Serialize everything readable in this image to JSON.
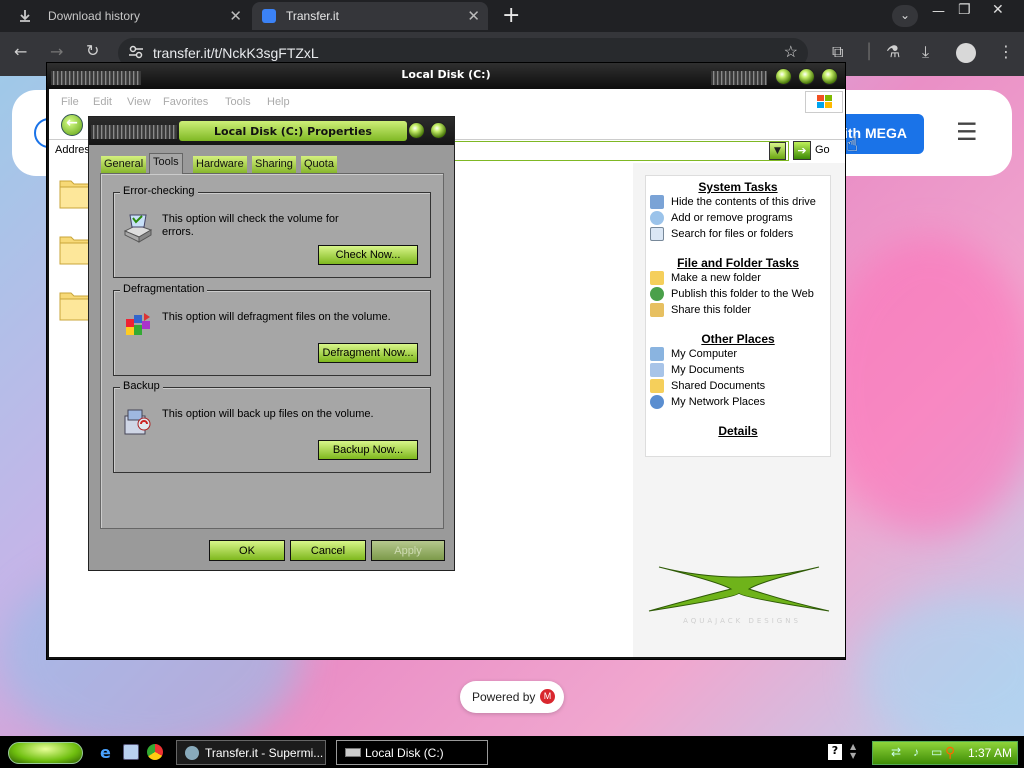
{
  "browser": {
    "tabs": [
      {
        "label": "Download history",
        "icon": "download-icon"
      },
      {
        "label": "Transfer.it",
        "icon": "transfer-icon"
      }
    ],
    "url": "transfer.it/t/NckK3sgFTZxL"
  },
  "page": {
    "mega_button": "ith MEGA",
    "powered_by": "Powered by"
  },
  "explorer": {
    "title": "Local Disk (C:)",
    "menu": [
      "File",
      "Edit",
      "View",
      "Favorites",
      "Tools",
      "Help"
    ],
    "address_label": "Addres",
    "go_label": "Go",
    "sections": [
      {
        "title": "System Tasks",
        "items": [
          "Hide the contents of this drive",
          "Add or remove programs",
          "Search for files or folders"
        ]
      },
      {
        "title": "File and Folder Tasks",
        "items": [
          "Make a new folder",
          "Publish this folder to the Web",
          "Share this folder"
        ]
      },
      {
        "title": "Other Places",
        "items": [
          "My Computer",
          "My Documents",
          "Shared Documents",
          "My Network Places"
        ]
      },
      {
        "title": "Details",
        "items": []
      }
    ],
    "watermark": "AQUAJACK  DESIGNS"
  },
  "dialog": {
    "title": "Local Disk (C:) Properties",
    "tabs": [
      "General",
      "Tools",
      "Hardware",
      "Sharing",
      "Quota"
    ],
    "active_tab": "Tools",
    "groups": [
      {
        "title": "Error-checking",
        "text": "This option will check the volume for errors.",
        "button": "Check Now..."
      },
      {
        "title": "Defragmentation",
        "text": "This option will defragment files on the volume.",
        "button": "Defragment Now..."
      },
      {
        "title": "Backup",
        "text": "This option will back up files on the volume.",
        "button": "Backup Now..."
      }
    ],
    "ok": "OK",
    "cancel": "Cancel",
    "apply": "Apply"
  },
  "taskbar": {
    "tasks": [
      "Transfer.it - Supermi...",
      "Local Disk (C:)"
    ],
    "clock": "1:37 AM"
  }
}
